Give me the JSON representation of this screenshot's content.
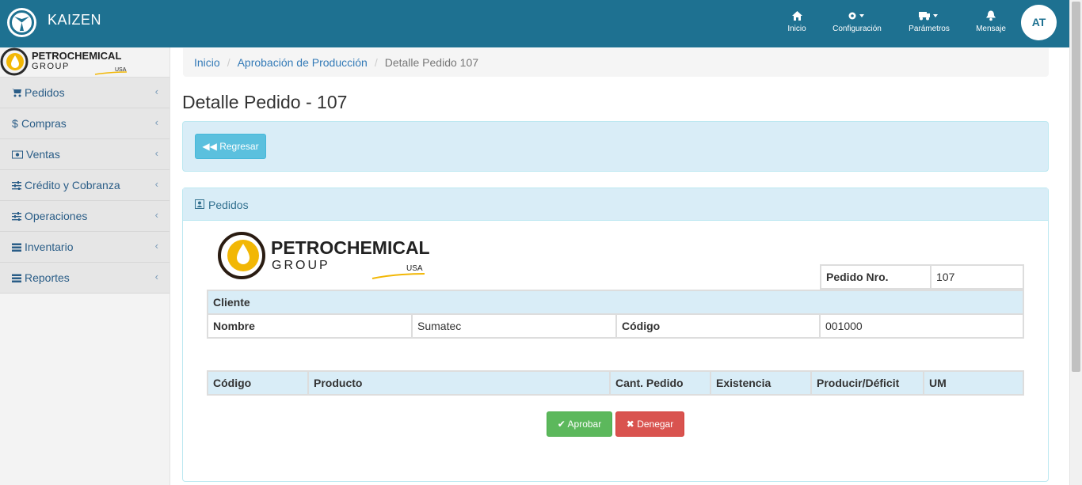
{
  "app": {
    "name": "KAIZEN",
    "avatar_initials": "AT"
  },
  "topnav": [
    {
      "label": "Inicio",
      "icon": "home-icon"
    },
    {
      "label": "Configuración",
      "icon": "gear-icon"
    },
    {
      "label": "Parámetros",
      "icon": "truck-icon"
    },
    {
      "label": "Mensaje",
      "icon": "bell-icon"
    }
  ],
  "brand_logo": {
    "line1": "PETROCHEMICAL",
    "line2": "GROUP",
    "line3": "USA"
  },
  "sidebar": {
    "items": [
      {
        "label": "Pedidos",
        "icon": "cart-icon"
      },
      {
        "label": "Compras",
        "icon": "dollar-icon"
      },
      {
        "label": "Ventas",
        "icon": "money-icon"
      },
      {
        "label": "Crédito y Cobranza",
        "icon": "sliders-icon"
      },
      {
        "label": "Operaciones",
        "icon": "sliders-icon"
      },
      {
        "label": "Inventario",
        "icon": "list-icon"
      },
      {
        "label": "Reportes",
        "icon": "list-icon"
      }
    ]
  },
  "breadcrumb": {
    "items": [
      "Inicio",
      "Aprobación de Producción"
    ],
    "current": "Detalle Pedido 107"
  },
  "page_title": "Detalle Pedido - 107",
  "back_button": "Regresar",
  "panel": {
    "title": "Pedidos",
    "order": {
      "label": "Pedido Nro.",
      "value": "107"
    },
    "client": {
      "header": "Cliente",
      "name_label": "Nombre",
      "name_value": "Sumatec",
      "code_label": "Código",
      "code_value": "001000"
    },
    "products": {
      "columns": [
        "Código",
        "Producto",
        "Cant. Pedido",
        "Existencia",
        "Producir/Déficit",
        "UM"
      ]
    }
  },
  "actions": {
    "approve": "Aprobar",
    "deny": "Denegar"
  },
  "colors": {
    "topbar": "#1e7191",
    "info": "#5bc0de",
    "success": "#5cb85c",
    "danger": "#d9534f",
    "logo_gold": "#f2b705"
  }
}
